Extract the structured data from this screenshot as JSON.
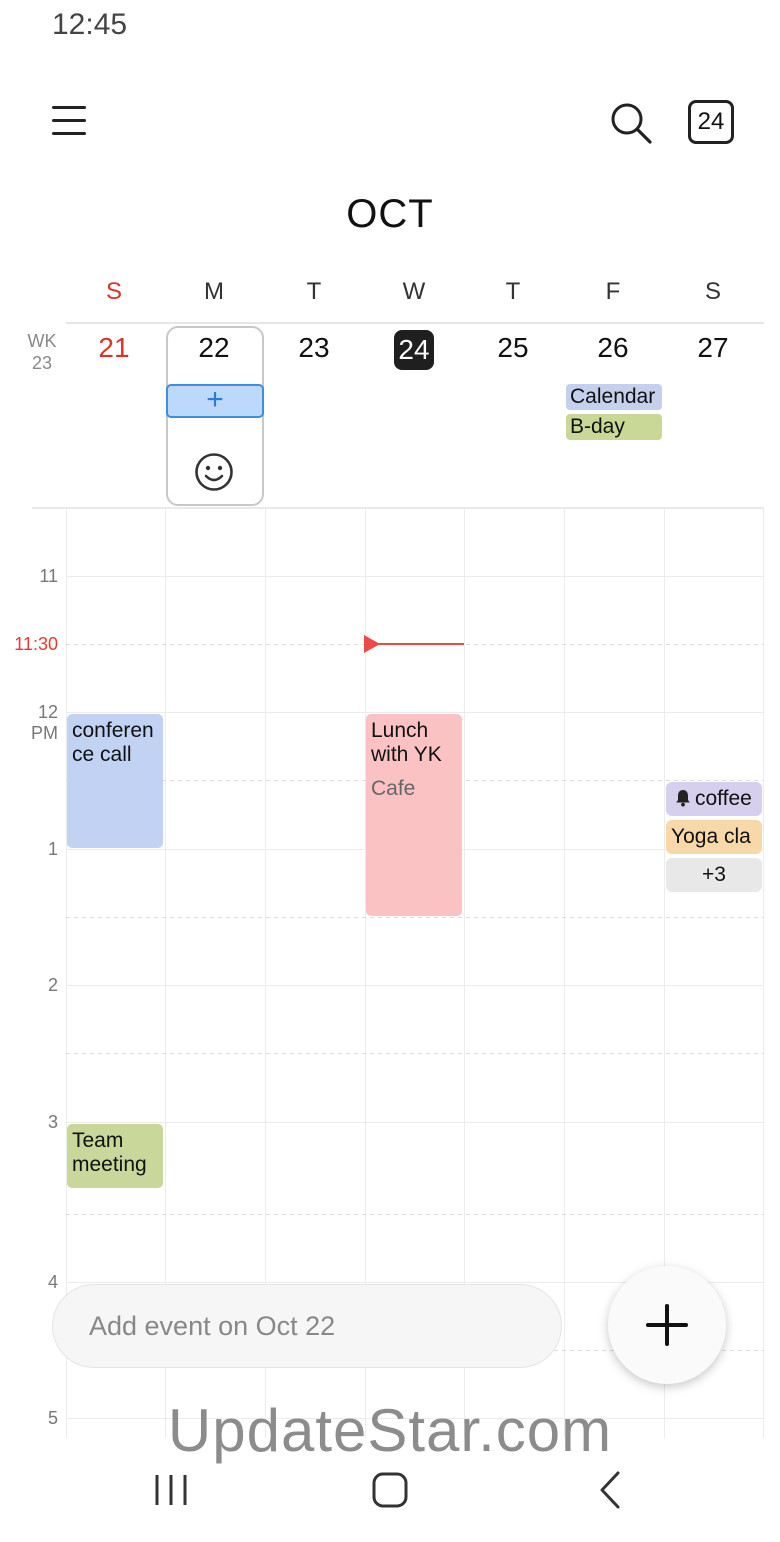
{
  "status_bar": {
    "time": "12:45"
  },
  "header": {
    "month": "OCT",
    "today_button": "24"
  },
  "week": {
    "label_top": "WK",
    "label_num": "23",
    "days": [
      {
        "dow": "S",
        "date": "21"
      },
      {
        "dow": "M",
        "date": "22"
      },
      {
        "dow": "T",
        "date": "23"
      },
      {
        "dow": "W",
        "date": "24"
      },
      {
        "dow": "T",
        "date": "25"
      },
      {
        "dow": "F",
        "date": "26"
      },
      {
        "dow": "S",
        "date": "27"
      }
    ],
    "selected_date": "22",
    "today": "24"
  },
  "quick_add": {
    "symbol": "+"
  },
  "allday_events": [
    {
      "title": "Calendar",
      "color": "#c4d0ec"
    },
    {
      "title": "B-day",
      "color": "#c9d896"
    }
  ],
  "time_grid": {
    "hours": [
      {
        "label": "11"
      },
      {
        "label_top": "12",
        "label_bottom": "PM"
      },
      {
        "label": "1"
      },
      {
        "label": "2"
      },
      {
        "label": "3"
      },
      {
        "label": "4"
      },
      {
        "label": "5"
      }
    ],
    "now": "11:30"
  },
  "events": [
    {
      "title": "conferen ce call",
      "color": "#c1d2f2"
    },
    {
      "title": "Lunch with YK",
      "location": "Cafe",
      "color": "#fbc2c4"
    },
    {
      "title": "Team meeting",
      "color": "#c9d89a"
    }
  ],
  "saturday_chips": [
    {
      "title": "coffee",
      "icon": "bell-icon",
      "color": "#d6cfee"
    },
    {
      "title": "Yoga cla",
      "color": "#f8d8a8"
    },
    {
      "title": "+3",
      "color": "#e8e8e8"
    }
  ],
  "add_bar": {
    "placeholder": "Add event on Oct 22"
  },
  "fab": {
    "symbol": "+"
  },
  "watermark": "UpdateStar.com"
}
